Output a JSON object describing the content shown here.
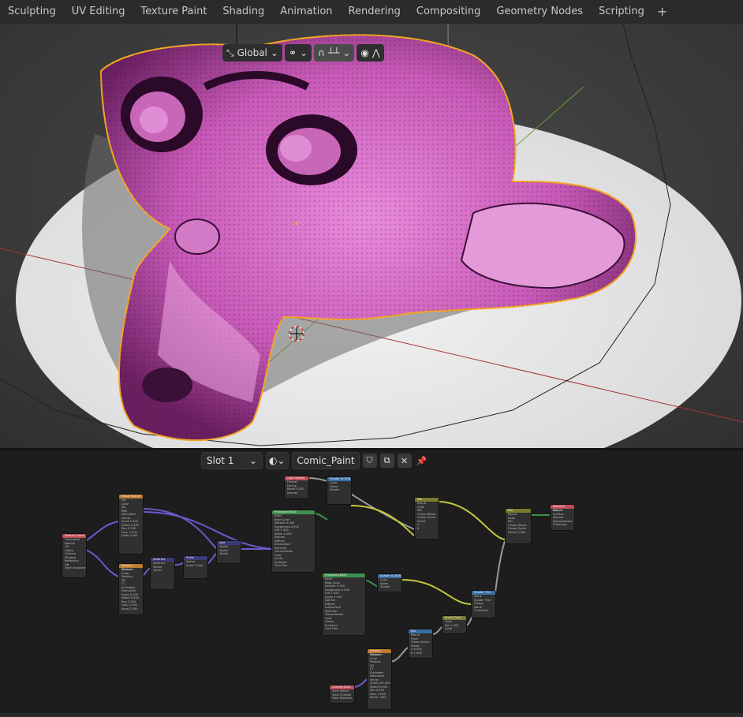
{
  "workspace_tabs": [
    "Sculpting",
    "UV Editing",
    "Texture Paint",
    "Shading",
    "Animation",
    "Rendering",
    "Compositing",
    "Geometry Nodes",
    "Scripting"
  ],
  "add_tab_label": "+",
  "viewport_header": {
    "orientation_label": "Global"
  },
  "node_editor_header": {
    "slot_label": "Slot 1",
    "material_name": "Comic_Paint"
  },
  "colors": {
    "accent_orange": "#f5a623",
    "mesh_pink": "#d96fc4",
    "frame_header_red": "#c24c55",
    "shader_green": "#3d8f4a",
    "vector_blue": "#3a6ea5",
    "link_yellow": "#c8c83c",
    "link_purple": "#6a5acd"
  },
  "nodes": [
    {
      "title": "Light Weight",
      "rows": [
        "Fresnel",
        "Facing",
        "Blend  0.500",
        "Normal"
      ]
    },
    {
      "title": "Shader to RGB",
      "rows": [
        "Color",
        "Alpha",
        "Shader"
      ]
    },
    {
      "title": "Geometry",
      "rows": [
        "Position",
        "Normal",
        "Tangent"
      ]
    },
    {
      "title": "Texture Coord",
      "rows": [
        "Generated",
        "Normal",
        "UV",
        "Object",
        "Camera",
        "Window",
        "Reflection",
        "Ob:",
        "From Instancer"
      ]
    },
    {
      "title": "Subtract",
      "rows": [
        "Subtract",
        "Vector",
        "Vector"
      ]
    },
    {
      "title": "Scale",
      "rows": [
        "Vector",
        "Scale 1.000"
      ]
    },
    {
      "title": "Add",
      "rows": [
        "Vector",
        "Vector",
        "Vector"
      ]
    },
    {
      "title": "Principled BSDF",
      "rows": [
        "BSDF",
        "Base Color",
        "Metallic 0.000",
        "Roughness 0.500",
        "IOR 1.450",
        "Alpha 1.000",
        "Normal",
        "Diffuse",
        "Subsurface",
        "Specular",
        "Transmission",
        "Coat",
        "Sheen",
        "Emission",
        "Thin Film"
      ]
    },
    {
      "title": "Noise Texture",
      "rows": [
        "Fac",
        "Color",
        "3D",
        "fBM",
        "Normalize",
        "Vector",
        "Scale 1.500",
        "Detail 2.000",
        "Rou 0.500",
        "Lacu 2.000",
        "Disto 0.000"
      ]
    },
    {
      "title": "Voronoi Texture",
      "rows": [
        "Distance",
        "Color",
        "Position",
        "3D",
        "F1",
        "Euclidean",
        "Normalize",
        "Scale 5.000",
        "Detail 0.000",
        "Rou 0.500",
        "Lacu 2.000",
        "Rand 1.000"
      ]
    },
    {
      "title": "Principled BSDF",
      "rows": [
        "BSDF",
        "Base Color",
        "Metallic 0.000",
        "Roughness 0.500",
        "IOR 1.450",
        "Alpha 1.000",
        "Normal",
        "Diffuse",
        "Subsurface",
        "Specular",
        "Transmission",
        "Coat",
        "Sheen",
        "Emission",
        "Thin Film"
      ]
    },
    {
      "title": "Shader to RGB",
      "rows": [
        "Color",
        "Alpha",
        "Shader"
      ]
    },
    {
      "title": "Mix",
      "rows": [
        "Result",
        "Color",
        "Mix",
        "Clamp Result",
        "Clamp Factor",
        "Factor",
        "A",
        "B"
      ]
    },
    {
      "title": "Mix",
      "rows": [
        "Result",
        "Color",
        "Mix",
        "Clamp Result",
        "Clamp Factor",
        "Factor 0.500"
      ]
    },
    {
      "title": "Material Output",
      "rows": [
        "All",
        "Surface",
        "Volume",
        "Displacement",
        "Thickness"
      ]
    },
    {
      "title": "Shader Thin",
      "rows": [
        "Value",
        "Shader Thin",
        "Clamp",
        "Value",
        "Threshold"
      ]
    },
    {
      "title": "Invert Color",
      "rows": [
        "Color",
        "Fac 1.000",
        "Color"
      ]
    },
    {
      "title": "Mix",
      "rows": [
        "Result",
        "Float",
        "Clamp Factor",
        "Factor",
        "A 0.500",
        "B 1.000"
      ]
    },
    {
      "title": "Voronoi Texture",
      "rows": [
        "Distance",
        "Color",
        "Position",
        "3D",
        "F1",
        "Euclidean",
        "Normalize",
        "Vector",
        "Scale 295.000",
        "Detail 0.000",
        "Rou 0.500",
        "Lacu 2.000",
        "Rand 1.000"
      ]
    },
    {
      "title": "Camera Data",
      "rows": [
        "View Vector",
        "View Z Depth",
        "View Distance"
      ]
    }
  ]
}
